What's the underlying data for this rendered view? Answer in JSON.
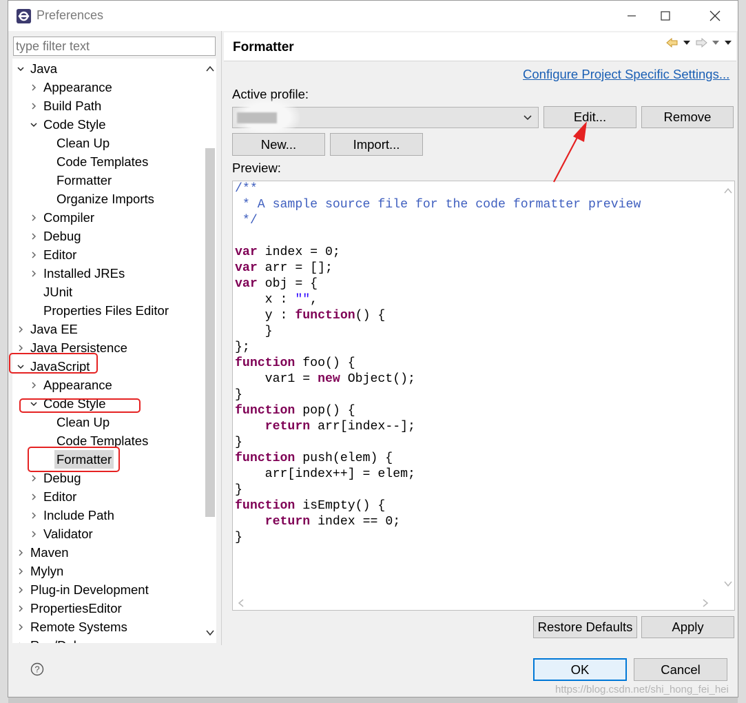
{
  "window": {
    "title": "Preferences"
  },
  "filter": {
    "placeholder": "type filter text"
  },
  "tree": {
    "items": [
      {
        "label": "Java",
        "level": 0,
        "state": "expanded"
      },
      {
        "label": "Appearance",
        "level": 1,
        "state": "collapsed"
      },
      {
        "label": "Build Path",
        "level": 1,
        "state": "collapsed"
      },
      {
        "label": "Code Style",
        "level": 1,
        "state": "expanded"
      },
      {
        "label": "Clean Up",
        "level": 2,
        "state": "leaf"
      },
      {
        "label": "Code Templates",
        "level": 2,
        "state": "leaf"
      },
      {
        "label": "Formatter",
        "level": 2,
        "state": "leaf"
      },
      {
        "label": "Organize Imports",
        "level": 2,
        "state": "leaf"
      },
      {
        "label": "Compiler",
        "level": 1,
        "state": "collapsed"
      },
      {
        "label": "Debug",
        "level": 1,
        "state": "collapsed"
      },
      {
        "label": "Editor",
        "level": 1,
        "state": "collapsed"
      },
      {
        "label": "Installed JREs",
        "level": 1,
        "state": "collapsed"
      },
      {
        "label": "JUnit",
        "level": 1,
        "state": "leaf"
      },
      {
        "label": "Properties Files Editor",
        "level": 1,
        "state": "leaf"
      },
      {
        "label": "Java EE",
        "level": 0,
        "state": "collapsed"
      },
      {
        "label": "Java Persistence",
        "level": 0,
        "state": "collapsed"
      },
      {
        "label": "JavaScript",
        "level": 0,
        "state": "expanded"
      },
      {
        "label": "Appearance",
        "level": 1,
        "state": "collapsed"
      },
      {
        "label": "Code Style",
        "level": 1,
        "state": "expanded"
      },
      {
        "label": "Clean Up",
        "level": 2,
        "state": "leaf"
      },
      {
        "label": "Code Templates",
        "level": 2,
        "state": "leaf"
      },
      {
        "label": "Formatter",
        "level": 2,
        "state": "leaf",
        "selected": true
      },
      {
        "label": "Debug",
        "level": 1,
        "state": "collapsed"
      },
      {
        "label": "Editor",
        "level": 1,
        "state": "collapsed"
      },
      {
        "label": "Include Path",
        "level": 1,
        "state": "collapsed"
      },
      {
        "label": "Validator",
        "level": 1,
        "state": "collapsed"
      },
      {
        "label": "Maven",
        "level": 0,
        "state": "collapsed"
      },
      {
        "label": "Mylyn",
        "level": 0,
        "state": "collapsed"
      },
      {
        "label": "Plug-in Development",
        "level": 0,
        "state": "collapsed"
      },
      {
        "label": "PropertiesEditor",
        "level": 0,
        "state": "collapsed"
      },
      {
        "label": "Remote Systems",
        "level": 0,
        "state": "collapsed"
      },
      {
        "label": "Run/Debug",
        "level": 0,
        "state": "collapsed"
      }
    ]
  },
  "page": {
    "title": "Formatter",
    "configure_link": "Configure Project Specific Settings...",
    "active_profile_label": "Active profile:",
    "preview_label": "Preview:",
    "buttons": {
      "edit": "Edit...",
      "remove": "Remove",
      "new": "New...",
      "import": "Import...",
      "restore_defaults": "Restore Defaults",
      "apply": "Apply"
    },
    "code_lines": [
      [
        [
          "cm",
          "/**"
        ]
      ],
      [
        [
          "cm",
          " * A sample source file for the code formatter preview"
        ]
      ],
      [
        [
          "cm",
          " */"
        ]
      ],
      [],
      [
        [
          "kw",
          "var"
        ],
        [
          "",
          " index = 0;"
        ]
      ],
      [
        [
          "kw",
          "var"
        ],
        [
          "",
          " arr = [];"
        ]
      ],
      [
        [
          "kw",
          "var"
        ],
        [
          "",
          " obj = {"
        ]
      ],
      [
        [
          "",
          "    x : "
        ],
        [
          "st",
          "\"\""
        ],
        [
          "",
          ","
        ]
      ],
      [
        [
          "",
          "    y : "
        ],
        [
          "kw",
          "function"
        ],
        [
          "",
          "() {"
        ]
      ],
      [
        [
          "",
          "    }"
        ]
      ],
      [
        [
          "",
          "};"
        ]
      ],
      [
        [
          "kw",
          "function"
        ],
        [
          "",
          " foo() {"
        ]
      ],
      [
        [
          "",
          "    var1 = "
        ],
        [
          "kw",
          "new"
        ],
        [
          "",
          " Object();"
        ]
      ],
      [
        [
          "",
          "}"
        ]
      ],
      [
        [
          "kw",
          "function"
        ],
        [
          "",
          " pop() {"
        ]
      ],
      [
        [
          "",
          "    "
        ],
        [
          "kw",
          "return"
        ],
        [
          "",
          " arr[index--];"
        ]
      ],
      [
        [
          "",
          "}"
        ]
      ],
      [
        [
          "kw",
          "function"
        ],
        [
          "",
          " push(elem) {"
        ]
      ],
      [
        [
          "",
          "    arr[index++] = elem;"
        ]
      ],
      [
        [
          "",
          "}"
        ]
      ],
      [
        [
          "kw",
          "function"
        ],
        [
          "",
          " isEmpty() {"
        ]
      ],
      [
        [
          "",
          "    "
        ],
        [
          "kw",
          "return"
        ],
        [
          "",
          " index == 0;"
        ]
      ],
      [
        [
          "",
          "}"
        ]
      ]
    ]
  },
  "footer": {
    "ok": "OK",
    "cancel": "Cancel"
  },
  "watermark": "https://blog.csdn.net/shi_hong_fei_hei",
  "colors": {
    "link": "#1a5fb4",
    "comment": "#3f5fbf",
    "keyword": "#7f0055",
    "string": "#2a00ff",
    "annotation_red": "#e52222",
    "ok_border": "#0078d7"
  }
}
